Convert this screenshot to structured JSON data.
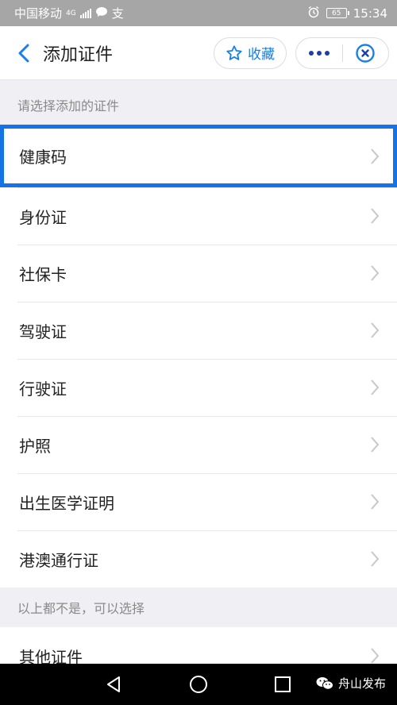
{
  "status_bar": {
    "carrier": "中国移动",
    "network": "4G",
    "extra_icon": "支",
    "battery": "65",
    "time": "15:34"
  },
  "header": {
    "title": "添加证件",
    "favorite_label": "收藏"
  },
  "section1": {
    "heading": "请选择添加的证件",
    "items": [
      {
        "label": "健康码",
        "highlighted": true
      },
      {
        "label": "身份证"
      },
      {
        "label": "社保卡"
      },
      {
        "label": "驾驶证"
      },
      {
        "label": "行驶证"
      },
      {
        "label": "护照"
      },
      {
        "label": "出生医学证明"
      },
      {
        "label": "港澳通行证"
      }
    ]
  },
  "section2": {
    "heading": "以上都不是，可以选择",
    "items": [
      {
        "label": "其他证件"
      }
    ]
  },
  "watermark": {
    "text": "舟山发布"
  },
  "colors": {
    "accent": "#1a7fe6",
    "highlight_border": "#1473e6",
    "page_background": "#efeff4"
  }
}
